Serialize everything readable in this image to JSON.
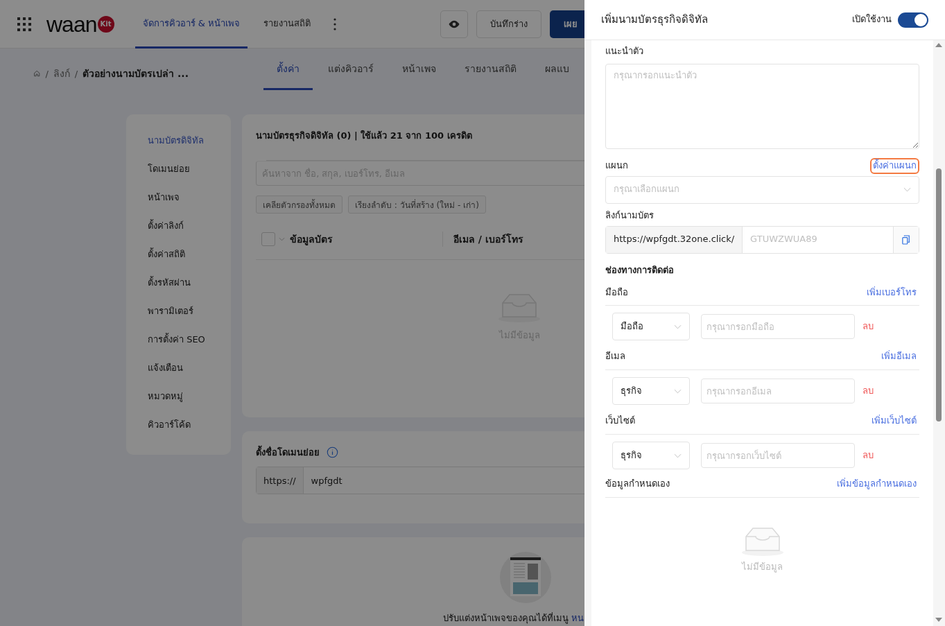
{
  "header": {
    "logo": "waan",
    "logo_badge": "Kit",
    "nav": [
      {
        "label": "จัดการคิวอาร์ & หน้าเพจ",
        "selected": true
      },
      {
        "label": "รายงานสถิติ",
        "selected": false
      }
    ],
    "draft_button": "บันทึกร่าง",
    "publish_button": "เผย"
  },
  "breadcrumb": {
    "separator": "/",
    "items": [
      "ลิงก์",
      "ตัวอย่างนามบัตรเปล่า ..."
    ]
  },
  "page_tabs": [
    {
      "label": "ตั้งค่า",
      "selected": true
    },
    {
      "label": "แต่งคิวอาร์",
      "selected": false
    },
    {
      "label": "หน้าเพจ",
      "selected": false
    },
    {
      "label": "รายงานสถิติ",
      "selected": false
    },
    {
      "label": "ผลแบ",
      "selected": false
    }
  ],
  "sidebar": {
    "items": [
      {
        "label": "นามบัตรดิจิทัล",
        "selected": true
      },
      {
        "label": "โดเมนย่อย",
        "selected": false
      },
      {
        "label": "หน้าเพจ",
        "selected": false
      },
      {
        "label": "ตั้งค่าลิงก์",
        "selected": false
      },
      {
        "label": "ตั้งค่าสถิติ",
        "selected": false
      },
      {
        "label": "ตั้งรหัสผ่าน",
        "selected": false
      },
      {
        "label": "พารามิเตอร์",
        "selected": false
      },
      {
        "label": "การตั้งค่า SEO",
        "selected": false
      },
      {
        "label": "แจ้งเตือน",
        "selected": false
      },
      {
        "label": "หมวดหมู่",
        "selected": false
      },
      {
        "label": "คิวอาร์โค้ด",
        "selected": false
      }
    ]
  },
  "cards_panel": {
    "title": "นามบัตรธุรกิจดิจิทัล (0) | ใช้แล้ว 21 จาก 100 เครดิต",
    "search": {
      "placeholder": "ค้นหาจาก ชื่อ, สกุล, เบอร์โทร, อีเมล"
    },
    "filters": [
      "เคลียตัวกรองทั้งหมด",
      "เรียงลำดับ : วันที่สร้าง (ใหม่ - เก่า)"
    ],
    "select_all_checked": false,
    "columns": [
      "ข้อมูลบัตร",
      "อีเมล / เบอร์โทร"
    ],
    "empty": "ไม่มีข้อมูล"
  },
  "subdomain": {
    "title": "ตั้งชื่อโดเมนย่อย",
    "prefix": "https://",
    "value": "wpfgdt"
  },
  "page_hint": {
    "text": "ปรับแต่งหน้าเพจของคุณได้ที่เมนู",
    "link": "หน"
  },
  "drawer": {
    "title": "เพิ่มนามบัตรธุรกิจดิจิทัล",
    "enable_label": "เปิดใช้งาน",
    "enabled": true,
    "intro": {
      "label": "แนะนำตัว",
      "placeholder": "กรุณากรอกแนะนำตัว"
    },
    "department": {
      "label": "แผนก",
      "link": "ตั้งค่าแผนก",
      "highlighted": true,
      "placeholder": "กรุณาเลือกแผนก"
    },
    "card_link": {
      "label": "ลิงก์นามบัตร",
      "prefix": "https://wpfgdt.32one.click/",
      "placeholder": "GTUWZWUA89"
    },
    "contact_title": "ช่องทางการติดต่อ",
    "contact_groups": [
      {
        "label": "มือถือ",
        "add": "เพิ่มเบอร์โทร",
        "rows": [
          {
            "type": "มือถือ",
            "placeholder": "กรุณากรอกมือถือ",
            "delete": "ลบ"
          }
        ]
      },
      {
        "label": "อีเมล",
        "add": "เพิ่มอีเมล",
        "rows": [
          {
            "type": "ธุรกิจ",
            "placeholder": "กรุณากรอกอีเมล",
            "delete": "ลบ"
          }
        ]
      },
      {
        "label": "เว็บไซต์",
        "add": "เพิ่มเว็บไซต์",
        "rows": [
          {
            "type": "ธุรกิจ",
            "placeholder": "กรุณากรอกเว็บไซต์",
            "delete": "ลบ"
          }
        ]
      }
    ],
    "custom": {
      "label": "ข้อมูลกำหนดเอง",
      "add": "เพิ่มข้อมูลกำหนดเอง",
      "empty": "ไม่มีข้อมูล"
    }
  }
}
